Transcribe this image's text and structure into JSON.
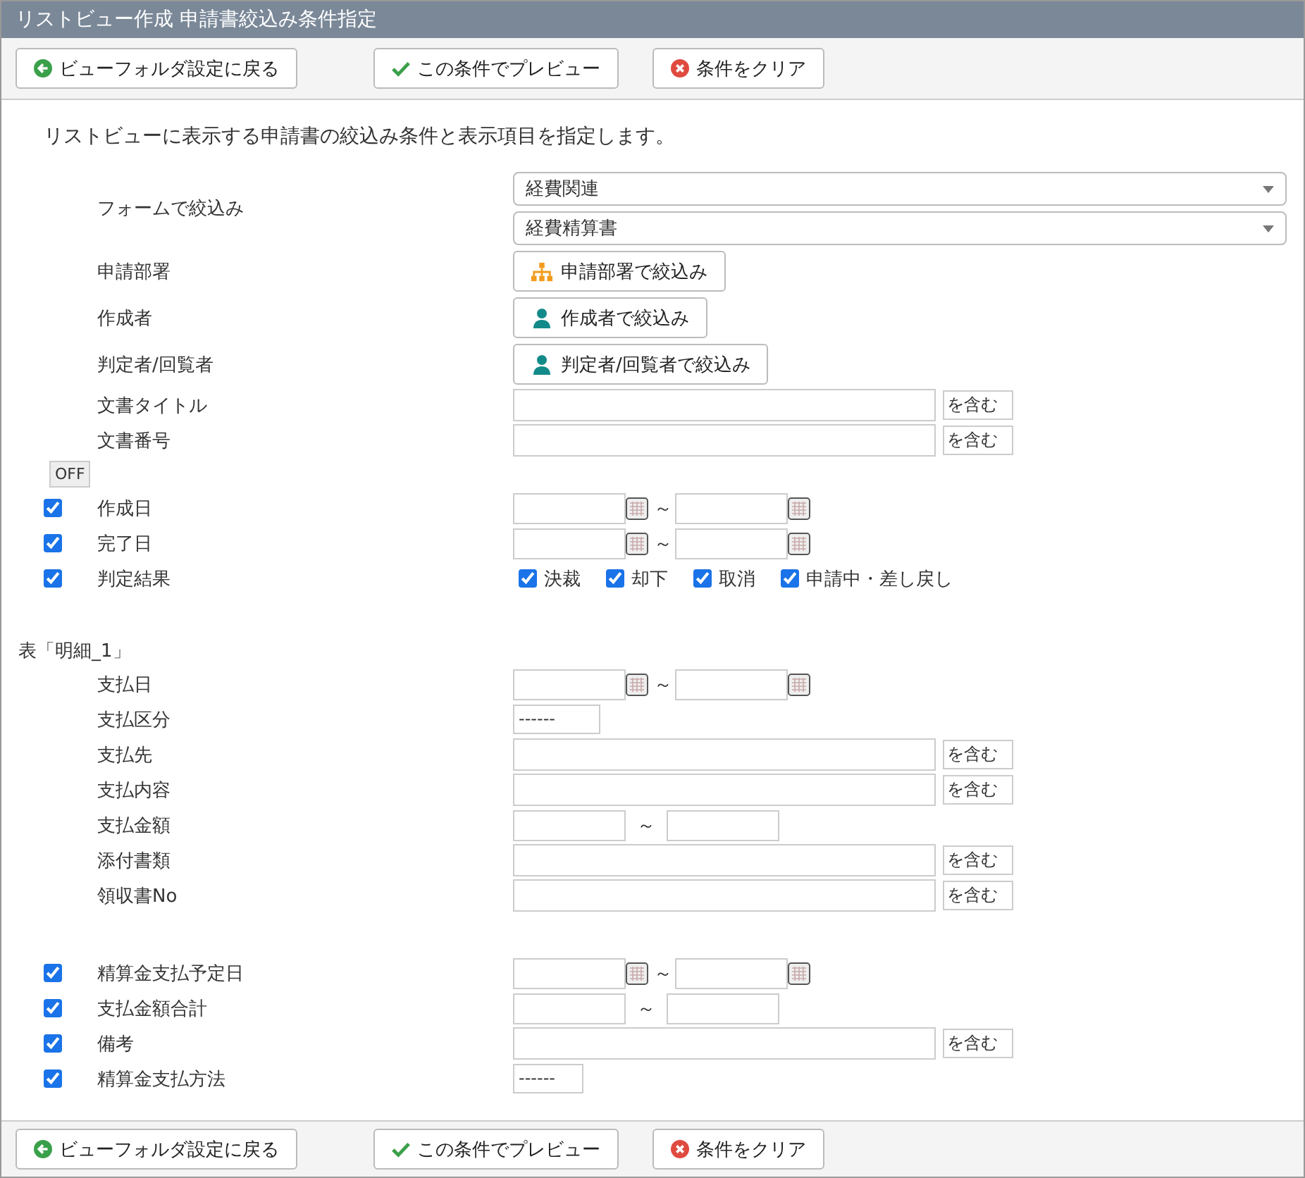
{
  "window": {
    "title": "リストビュー作成 申請書絞込み条件指定"
  },
  "toolbar": [
    {
      "kind": "back",
      "label": "ビューフォルダ設定に戻る"
    },
    {
      "kind": "preview",
      "label": "この条件でプレビュー"
    },
    {
      "kind": "clear",
      "label": "条件をクリア"
    }
  ],
  "description": "リストビューに表示する申請書の絞込み条件と表示項目を指定します。",
  "sections": [
    {
      "rows": [
        {
          "kind": "select-pair",
          "label": "フォームで絞込み",
          "selects": [
            {
              "value": "経費関連"
            },
            {
              "value": "経費精算書"
            }
          ]
        },
        {
          "kind": "picker",
          "label": "申請部署",
          "button": {
            "kind": "org",
            "label": "申請部署で絞込み"
          }
        },
        {
          "kind": "picker",
          "label": "作成者",
          "button": {
            "kind": "person",
            "label": "作成者で絞込み"
          }
        },
        {
          "kind": "picker",
          "label": "判定者/回覧者",
          "button": {
            "kind": "person",
            "label": "判定者/回覧者で絞込み"
          }
        },
        {
          "kind": "text",
          "label": "文書タイトル",
          "suffix": "を含む"
        },
        {
          "kind": "text",
          "label": "文書番号",
          "suffix": "を含む"
        }
      ]
    },
    {
      "toggle": "OFF",
      "rows": [
        {
          "kind": "date-range",
          "label": "作成日",
          "checked": true,
          "separator": "～"
        },
        {
          "kind": "date-range",
          "label": "完了日",
          "checked": true,
          "separator": "～"
        },
        {
          "kind": "results",
          "label": "判定結果",
          "checked": true,
          "options": [
            {
              "label": "決裁",
              "checked": true
            },
            {
              "label": "却下",
              "checked": true
            },
            {
              "label": "取消",
              "checked": true
            },
            {
              "label": "申請中・差し戻し",
              "checked": true
            }
          ]
        }
      ]
    },
    {
      "heading": "表「明細_1」",
      "rows": [
        {
          "kind": "date-range",
          "label": "支払日",
          "separator": "～"
        },
        {
          "kind": "select",
          "label": "支払区分",
          "value": "------"
        },
        {
          "kind": "text",
          "label": "支払先",
          "suffix": "を含む"
        },
        {
          "kind": "text",
          "label": "支払内容",
          "suffix": "を含む"
        },
        {
          "kind": "number-range",
          "label": "支払金額",
          "separator": "～"
        },
        {
          "kind": "text",
          "label": "添付書類",
          "suffix": "を含む"
        },
        {
          "kind": "text",
          "label": "領収書No",
          "suffix": "を含む"
        }
      ]
    },
    {
      "rows": [
        {
          "kind": "date-range",
          "label": "精算金支払予定日",
          "checked": true,
          "separator": "～"
        },
        {
          "kind": "number-range",
          "label": "支払金額合計",
          "checked": true,
          "separator": "～"
        },
        {
          "kind": "text",
          "label": "備考",
          "checked": true,
          "suffix": "を含む"
        },
        {
          "kind": "compact-select",
          "label": "精算金支払方法",
          "checked": true,
          "value": "------"
        }
      ]
    }
  ],
  "footer": [
    {
      "kind": "back",
      "label": "ビューフォルダ設定に戻る"
    },
    {
      "kind": "preview",
      "label": "この条件でプレビュー"
    },
    {
      "kind": "clear",
      "label": "条件をクリア"
    }
  ]
}
